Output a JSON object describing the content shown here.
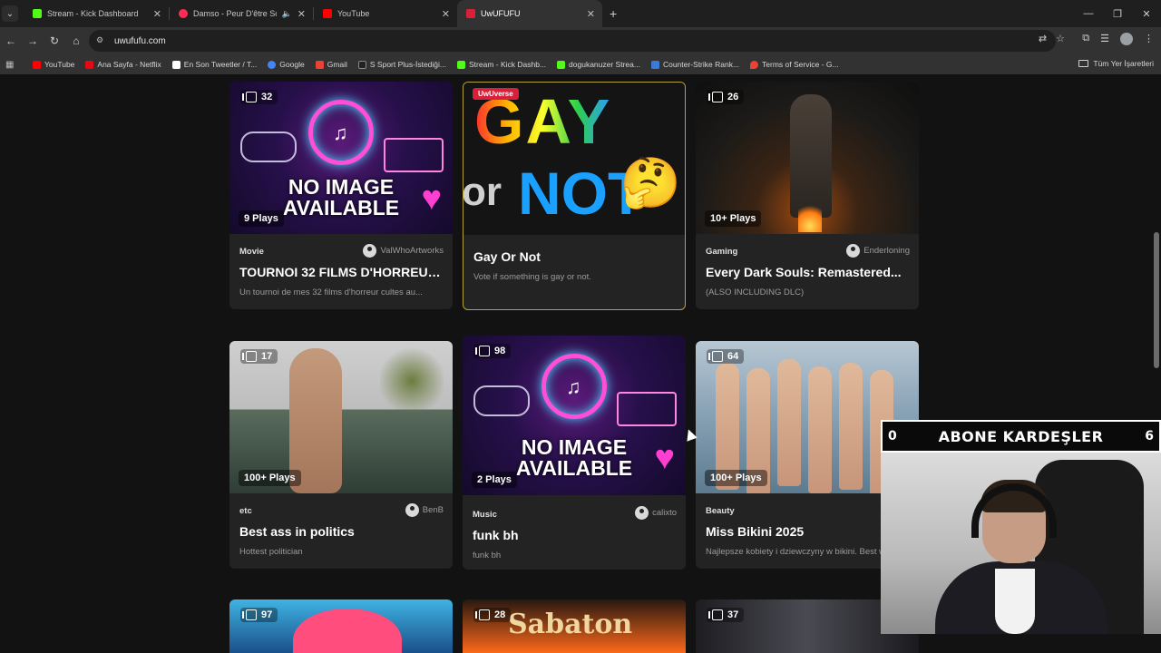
{
  "browser": {
    "tabs": [
      {
        "title": "Stream - Kick Dashboard",
        "favicon_color": "#53fc18",
        "active": false
      },
      {
        "title": "Damso - Peur D'être Sobre",
        "favicon_color": "#ff2d55",
        "active": false
      },
      {
        "title": "YouTube",
        "favicon_color": "#ff0000",
        "active": false
      },
      {
        "title": "UwUFUFU",
        "favicon_color": "#d8203b",
        "active": true
      }
    ],
    "new_tab": "+",
    "url": "uwufufu.com",
    "bookmarks": [
      {
        "label": "YouTube",
        "color": "#ff0000"
      },
      {
        "label": "Ana Sayfa - Netflix",
        "color": "#e50914"
      },
      {
        "label": "En Son Tweetler / T...",
        "color": "#ffffff"
      },
      {
        "label": "Google",
        "color": "#4285f4"
      },
      {
        "label": "Gmail",
        "color": "#ea4335"
      },
      {
        "label": "S Sport Plus-İstediği...",
        "color": "#222222"
      },
      {
        "label": "Stream - Kick Dashb...",
        "color": "#53fc18"
      },
      {
        "label": "dogukanuzer Strea...",
        "color": "#53fc18"
      },
      {
        "label": "Counter-Strike Rank...",
        "color": "#3b7bd6"
      },
      {
        "label": "Terms of Service - G...",
        "color": "#ea4335"
      }
    ],
    "bookmarks_right": "Tüm Yer İşaretleri"
  },
  "cards": [
    {
      "count": "32",
      "plays": "9 Plays",
      "category": "Movie",
      "author": "ValWhoArtworks",
      "title": "TOURNOI 32 FILMS D'HORREUR...",
      "desc": "Un tournoi de mes 32 films d'horreur cultes au...",
      "thumb_text": "NO IMAGE AVAILABLE"
    },
    {
      "badge": "UwUverse",
      "title": "Gay Or Not",
      "desc": "Vote if something is gay or not.",
      "thumb_word_1": "GAY",
      "thumb_word_or": "or",
      "thumb_word_2": "NOT"
    },
    {
      "count": "26",
      "plays": "10+ Plays",
      "category": "Gaming",
      "author": "Enderloning",
      "title": "Every Dark Souls: Remastered...",
      "desc": "(ALSO INCLUDING DLC)"
    },
    {
      "count": "17",
      "plays": "100+ Plays",
      "category": "etc",
      "author": "BenB",
      "title": "Best ass in politics",
      "desc": "Hottest politician"
    },
    {
      "count": "98",
      "plays": "2 Plays",
      "category": "Music",
      "author": "calixto",
      "title": "funk bh",
      "desc": "funk bh",
      "thumb_text": "NO IMAGE AVAILABLE"
    },
    {
      "count": "64",
      "plays": "100+ Plays",
      "category": "Beauty",
      "title": "Miss Bikini 2025",
      "desc": "Najlepsze kobiety i dziewczyny w bikini. Best w..."
    },
    {
      "count": "97"
    },
    {
      "count": "28",
      "thumb_text": "Sabaton"
    },
    {
      "count": "37"
    }
  ],
  "overlay": {
    "left_num": "0",
    "banner": "ABONE KARDEŞLER",
    "right_num": "6"
  }
}
